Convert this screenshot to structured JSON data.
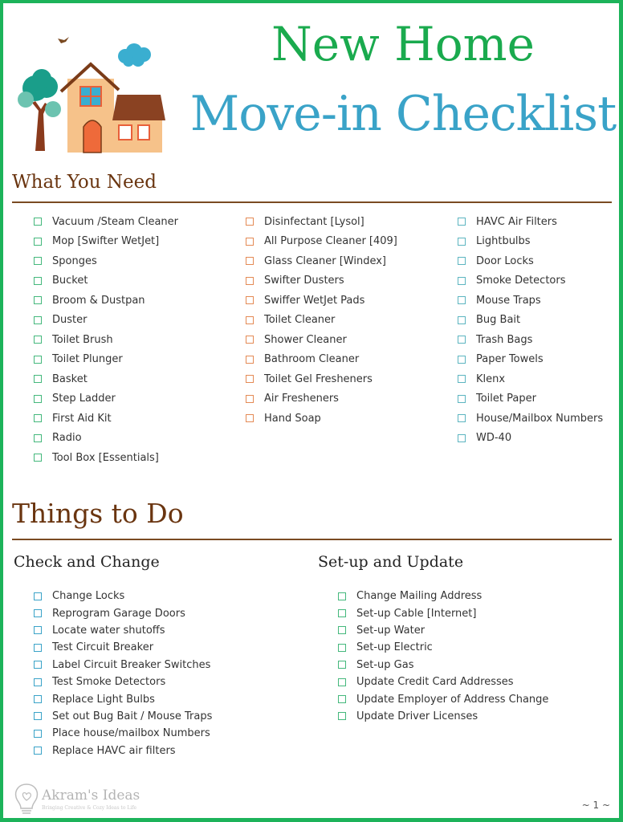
{
  "header": {
    "title_line1": "New Home",
    "title_line2": "Move-in Checklist"
  },
  "colors": {
    "border": "#1db35a",
    "title_green": "#1aaa4e",
    "title_blue": "#3aa3c8",
    "section_brown": "#6a3510",
    "checkbox_green": "#44b87c",
    "checkbox_orange": "#e48a55",
    "checkbox_teal": "#5cb5c0",
    "checkbox_blue": "#3aa3c8"
  },
  "what_you_need": {
    "heading": "What You Need",
    "column1": [
      "Vacuum /Steam Cleaner",
      "Mop [Swifter WetJet]",
      "Sponges",
      "Bucket",
      "Broom & Dustpan",
      "Duster",
      "Toilet Brush",
      "Toilet Plunger",
      "Basket",
      "Step Ladder",
      "First Aid Kit",
      "Radio",
      "Tool Box [Essentials]"
    ],
    "column2": [
      "Disinfectant [Lysol]",
      "All Purpose Cleaner [409]",
      "Glass Cleaner [Windex]",
      "Swifter Dusters",
      "Swiffer WetJet Pads",
      "Toilet Cleaner",
      "Shower Cleaner",
      "Bathroom Cleaner",
      "Toilet Gel Fresheners",
      "Air Fresheners",
      "Hand Soap"
    ],
    "column3": [
      "HAVC Air Filters",
      "Lightbulbs",
      "Door Locks",
      "Smoke Detectors",
      "Mouse Traps",
      "Bug Bait",
      "Trash Bags",
      "Paper Towels",
      "Klenx",
      "Toilet Paper",
      "House/Mailbox Numbers",
      "WD-40"
    ]
  },
  "things_to_do": {
    "heading": "Things to Do",
    "check_and_change": {
      "heading": "Check and Change",
      "items": [
        "Change Locks",
        "Reprogram Garage Doors",
        "Locate water shutoffs",
        "Test Circuit Breaker",
        "Label Circuit Breaker Switches",
        "Test Smoke Detectors",
        "Replace Light Bulbs",
        "Set out Bug Bait / Mouse Traps",
        "Place house/mailbox Numbers",
        "Replace HAVC air filters"
      ]
    },
    "setup_and_update": {
      "heading": "Set-up and Update",
      "items": [
        "Change Mailing Address",
        "Set-up Cable [Internet]",
        "Set-up Water",
        "Set-up Electric",
        "Set-up Gas",
        "Update Credit Card Addresses",
        "Update Employer of Address Change",
        "Update Driver Licenses"
      ]
    }
  },
  "footer": {
    "logo_name": "Akram's Ideas",
    "logo_tagline": "Bringing Creative & Cozy Ideas to Life",
    "page_number": "~ 1 ~"
  }
}
